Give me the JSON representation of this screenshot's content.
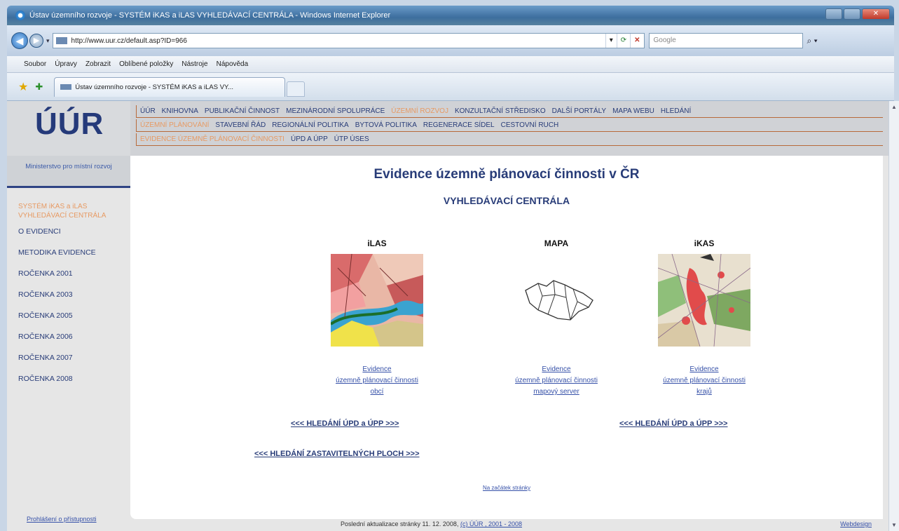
{
  "window": {
    "title": "Ústav územního rozvoje - SYSTÉM iKAS a iLAS VYHLEDÁVACÍ CENTRÁLA - Windows Internet Explorer",
    "url": "http://www.uur.cz/default.asp?ID=966",
    "search_placeholder": "Google"
  },
  "menu": [
    "Soubor",
    "Úpravy",
    "Zobrazit",
    "Oblíbené položky",
    "Nástroje",
    "Nápověda"
  ],
  "tab": {
    "label": "Ústav územního rozvoje - SYSTÉM iKAS a iLAS VY..."
  },
  "site": {
    "logo": "ÚÚR",
    "ministry": "Ministerstvo pro místní rozvoj",
    "nav_row1": [
      "ÚÚR",
      "KNIHOVNA",
      "PUBLIKAČNÍ ČINNOST",
      "MEZINÁRODNÍ SPOLUPRÁCE",
      "ÚZEMNÍ ROZVOJ",
      "KONZULTAČNÍ STŘEDISKO",
      "DALŠÍ PORTÁLY",
      "MAPA WEBU",
      "HLEDÁNÍ"
    ],
    "nav_row2": [
      "ÚZEMNÍ PLÁNOVÁNÍ",
      "STAVEBNÍ ŘÁD",
      "REGIONÁLNÍ POLITIKA",
      "BYTOVÁ POLITIKA",
      "REGENERACE SÍDEL",
      "CESTOVNÍ RUCH"
    ],
    "nav_row3": [
      "EVIDENCE ÚZEMNĚ PLÁNOVACÍ ČINNOSTI",
      "ÚPD A ÚPP",
      "ÚTP ÚSES"
    ],
    "nav_active": [
      "ÚZEMNÍ ROZVOJ",
      "ÚZEMNÍ PLÁNOVÁNÍ",
      "EVIDENCE ÚZEMNĚ PLÁNOVACÍ ČINNOSTI"
    ]
  },
  "sidebar": {
    "active": "SYSTÉM iKAS a iLAS VYHLEDÁVACÍ CENTRÁLA",
    "items": [
      "O EVIDENCI",
      "METODIKA EVIDENCE",
      "ROČENKA 2001",
      "ROČENKA 2003",
      "ROČENKA 2005",
      "ROČENKA 2006",
      "ROČENKA 2007",
      "ROČENKA 2008"
    ],
    "footer_link": "Prohlášení o přístupnosti"
  },
  "main": {
    "title": "Evidence územně plánovací činnosti v ČR",
    "subtitle": "VYHLEDÁVACÍ CENTRÁLA",
    "columns": [
      {
        "title": "iLAS",
        "link_lines": [
          "Evidence",
          "územně plánovací činnosti",
          "obcí"
        ]
      },
      {
        "title": "MAPA",
        "link_lines": [
          "Evidence",
          "územně plánovací činnosti",
          "mapový server"
        ]
      },
      {
        "title": "iKAS",
        "link_lines": [
          "Evidence",
          "územně plánovací činnosti",
          "krajů"
        ]
      }
    ],
    "search_upd_left": "<<< HLEDÁNÍ ÚPD a ÚPP >>>",
    "search_upd_right": "<<< HLEDÁNÍ ÚPD a ÚPP >>>",
    "search_zastav": "<<< HLEDÁNÍ ZASTAVITELNÝCH PLOCH >>>",
    "top_link": "Na začátek stránky"
  },
  "footer": {
    "updated": "Poslední aktualizace stránky 11. 12. 2008,",
    "copyright": "(c) ÚÚR , 2001 - 2008",
    "webdesign": "Webdesign"
  },
  "colors": {
    "brand_blue": "#283c78",
    "active_orange": "#e79a63",
    "link_blue": "#3550a8"
  }
}
